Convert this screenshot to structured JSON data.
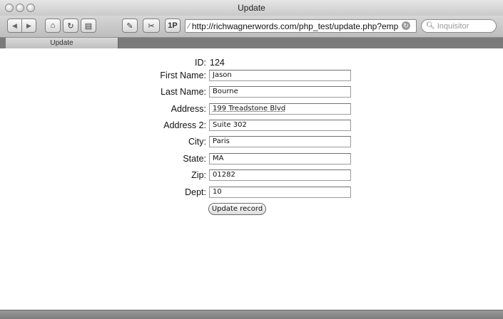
{
  "window": {
    "title": "Update"
  },
  "toolbar": {
    "url": "http://richwagnerwords.com/php_test/update.php?emp",
    "search_placeholder": "Inquisitor",
    "onepass_label": "1P"
  },
  "tab": {
    "label": "Update"
  },
  "form": {
    "id_label": "ID:",
    "id_value": "124",
    "fields": [
      {
        "label": "First Name:",
        "value": "Jason"
      },
      {
        "label": "Last Name:",
        "value": "Bourne"
      },
      {
        "label": "Address:",
        "value": "199 Treadstone Blvd"
      },
      {
        "label": "Address 2:",
        "value": "Suite 302"
      },
      {
        "label": "City:",
        "value": "Paris"
      },
      {
        "label": "State:",
        "value": "MA"
      },
      {
        "label": "Zip:",
        "value": "01282"
      },
      {
        "label": "Dept:",
        "value": "10"
      }
    ],
    "submit_label": "Update record"
  }
}
